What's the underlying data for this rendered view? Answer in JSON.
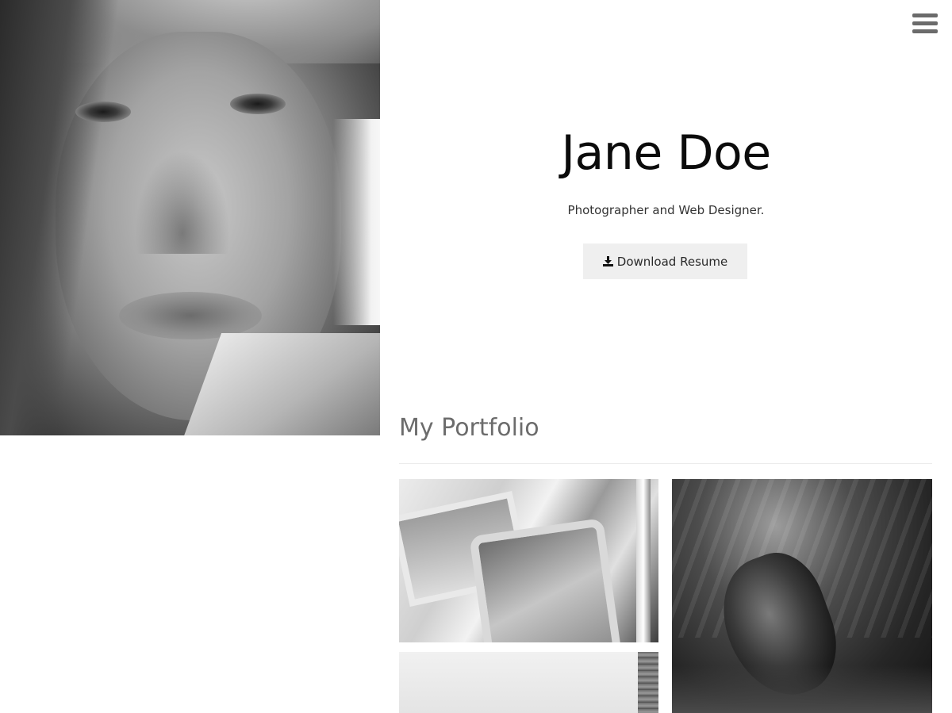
{
  "profile": {
    "name": "Jane Doe",
    "tagline": "Photographer and Web Designer.",
    "download_label": "Download Resume"
  },
  "menu": {
    "icon": "hamburger-menu-icon"
  },
  "portfolio": {
    "title": "My Portfolio",
    "items": [
      {
        "alt": "car-window-photo"
      },
      {
        "alt": "underwater-photo"
      },
      {
        "alt": "light-landscape-photo"
      }
    ]
  },
  "colors": {
    "button_bg": "#efefef",
    "title_color": "#0b0b0b",
    "section_title_color": "#6c6c6c",
    "menu_icon_color": "#6b6b6b"
  }
}
